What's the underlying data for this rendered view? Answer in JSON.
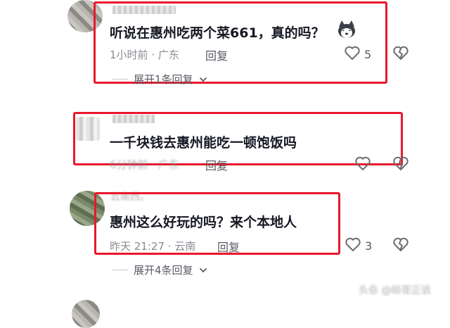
{
  "comments": [
    {
      "text": "听说在惠州吃两个菜661，真的吗？",
      "time": "1小时前",
      "location": "广东",
      "reply_label": "回复",
      "likes": "5",
      "expand_label": "展开1条回复"
    },
    {
      "text": "一千块钱去惠州能吃一顿饱饭吗",
      "time": "6分钟前",
      "location": "广东",
      "reply_label": "回复",
      "likes": "",
      "expand_label": ""
    },
    {
      "username": "云南西。",
      "text": "惠州这么好玩的吗？来个本地人",
      "time": "昨天 21:27",
      "location": "云南",
      "reply_label": "回复",
      "likes": "3",
      "expand_label": "展开4条回复"
    }
  ],
  "separator": "·",
  "watermark": "头条 @峰哥正读",
  "colors": {
    "highlight": "#e8182c",
    "meta": "#8a8b91",
    "text": "#161823"
  },
  "icons": [
    "emoji-husky-icon",
    "heart-outline-icon",
    "heart-broken-icon",
    "chevron-down-icon"
  ]
}
